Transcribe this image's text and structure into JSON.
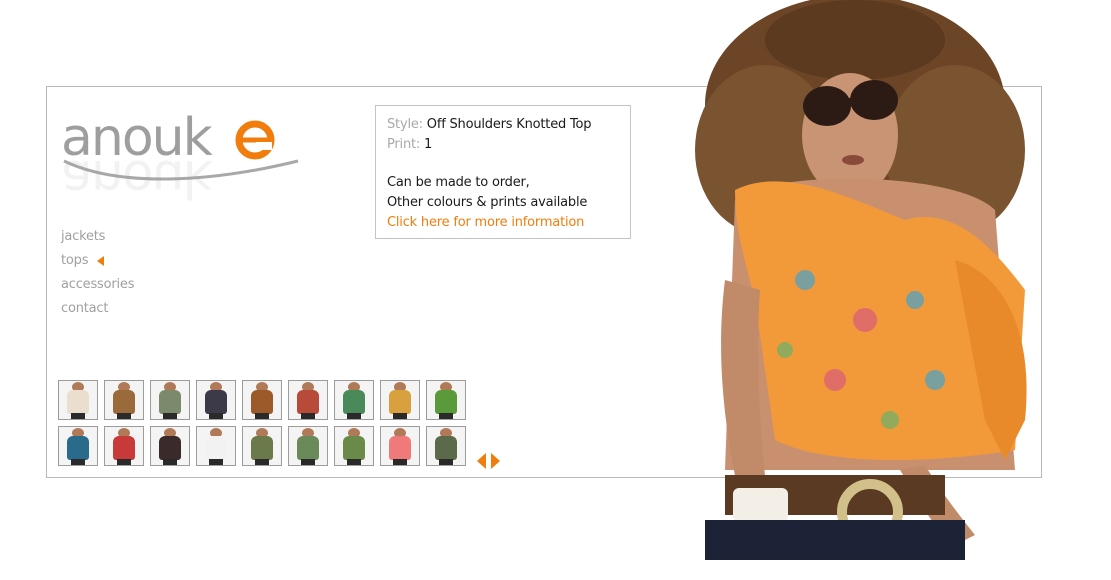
{
  "brand": {
    "name": "anouke",
    "accent_color": "#f07d0c",
    "text_color": "#a0a0a0"
  },
  "nav": {
    "items": [
      {
        "label": "jackets",
        "active": false
      },
      {
        "label": "tops",
        "active": true
      },
      {
        "label": "accessories",
        "active": false
      },
      {
        "label": "contact",
        "active": false
      }
    ]
  },
  "product": {
    "style_label": "Style:",
    "style_value": "Off Shoulders Knotted Top",
    "print_label": "Print:",
    "print_value": "1",
    "line1": "Can be made to order,",
    "line2": "Other colours & prints available",
    "more_info_link": "Click here for more information"
  },
  "thumbnails": [
    {
      "color": "#eadfcf"
    },
    {
      "color": "#9a6a3a"
    },
    {
      "color": "#7a8a6a"
    },
    {
      "color": "#3c3a48"
    },
    {
      "color": "#9c5a2a"
    },
    {
      "color": "#b84a3a"
    },
    {
      "color": "#4a8a5a"
    },
    {
      "color": "#d9a040"
    },
    {
      "color": "#5a9a3a"
    },
    {
      "color": "#2a6a8a"
    },
    {
      "color": "#c83a3a"
    },
    {
      "color": "#3a2a2a"
    },
    {
      "color": "#f2f2f2"
    },
    {
      "color": "#6a7a4a"
    },
    {
      "color": "#6a8a5a"
    },
    {
      "color": "#6a8a4a"
    },
    {
      "color": "#f07a7a"
    },
    {
      "color": "#5a6a4a"
    }
  ],
  "pager": {
    "prev_icon": "arrow-left-icon",
    "next_icon": "arrow-right-icon"
  }
}
